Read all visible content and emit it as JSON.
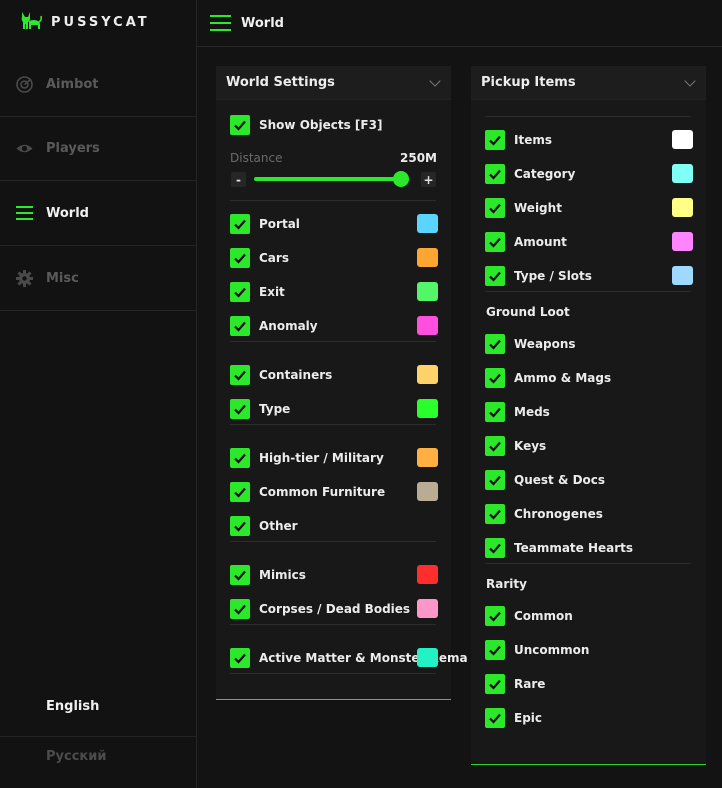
{
  "brand": {
    "name": "PUSSYCAT",
    "logo_icon": "cat-icon"
  },
  "topbar": {
    "title": "World",
    "menu_icon": "hamburger-menu-icon"
  },
  "colors": {
    "accent": "#2be82b",
    "background": "#131313",
    "panel": "#181818"
  },
  "sidebar": {
    "items": [
      {
        "label": "Aimbot",
        "icon": "radar-icon",
        "active": false
      },
      {
        "label": "Players",
        "icon": "eye-icon",
        "active": false
      },
      {
        "label": "World",
        "icon": "hamburger-icon",
        "active": true
      },
      {
        "label": "Misc",
        "icon": "gear-icon",
        "active": false
      }
    ],
    "languages": [
      {
        "label": "English",
        "active": true
      },
      {
        "label": "Русский",
        "active": false
      }
    ]
  },
  "world_settings": {
    "title": "World Settings",
    "show_objects": {
      "label": "Show Objects [F3]",
      "checked": true
    },
    "distance": {
      "label": "Distance",
      "value": "250M",
      "minus": "-",
      "plus": "+",
      "fraction": 0.98
    },
    "groups": [
      [
        {
          "label": "Portal",
          "checked": true,
          "color": "#5ad5ff"
        },
        {
          "label": "Cars",
          "checked": true,
          "color": "#ffa531"
        },
        {
          "label": "Exit",
          "checked": true,
          "color": "#55f56a"
        },
        {
          "label": "Anomaly",
          "checked": true,
          "color": "#ff4fde"
        }
      ],
      [
        {
          "label": "Containers",
          "checked": true,
          "color": "#ffd26a"
        },
        {
          "label": "Type",
          "checked": true,
          "color": "#2bff2b"
        }
      ],
      [
        {
          "label": "High-tier / Military",
          "checked": true,
          "color": "#ffb040"
        },
        {
          "label": "Common Furniture",
          "checked": true,
          "color": "#b8ad92"
        },
        {
          "label": "Other",
          "checked": true,
          "color": null
        }
      ],
      [
        {
          "label": "Mimics",
          "checked": true,
          "color": "#ff2e2e"
        },
        {
          "label": "Corpses / Dead Bodies",
          "checked": true,
          "color": "#ff96c8"
        }
      ],
      [
        {
          "label": "Active Matter & Monster Rema",
          "checked": true,
          "color": "#22f2c4"
        }
      ]
    ]
  },
  "pickup_items": {
    "title": "Pickup Items",
    "items": [
      {
        "label": "Items",
        "checked": true,
        "color": "#ffffff"
      },
      {
        "label": "Category",
        "checked": true,
        "color": "#7ffff6"
      },
      {
        "label": "Weight",
        "checked": true,
        "color": "#ffff88"
      },
      {
        "label": "Amount",
        "checked": true,
        "color": "#ff84ff"
      },
      {
        "label": "Type / Slots",
        "checked": true,
        "color": "#9fd9ff"
      }
    ],
    "ground_loot": {
      "title": "Ground Loot",
      "items": [
        {
          "label": "Weapons",
          "checked": true
        },
        {
          "label": "Ammo & Mags",
          "checked": true
        },
        {
          "label": "Meds",
          "checked": true
        },
        {
          "label": "Keys",
          "checked": true
        },
        {
          "label": "Quest & Docs",
          "checked": true
        },
        {
          "label": "Chronogenes",
          "checked": true
        },
        {
          "label": "Teammate Hearts",
          "checked": true
        }
      ]
    },
    "rarity": {
      "title": "Rarity",
      "items": [
        {
          "label": "Common",
          "checked": true
        },
        {
          "label": "Uncommon",
          "checked": true
        },
        {
          "label": "Rare",
          "checked": true
        },
        {
          "label": "Epic",
          "checked": true
        }
      ]
    }
  }
}
